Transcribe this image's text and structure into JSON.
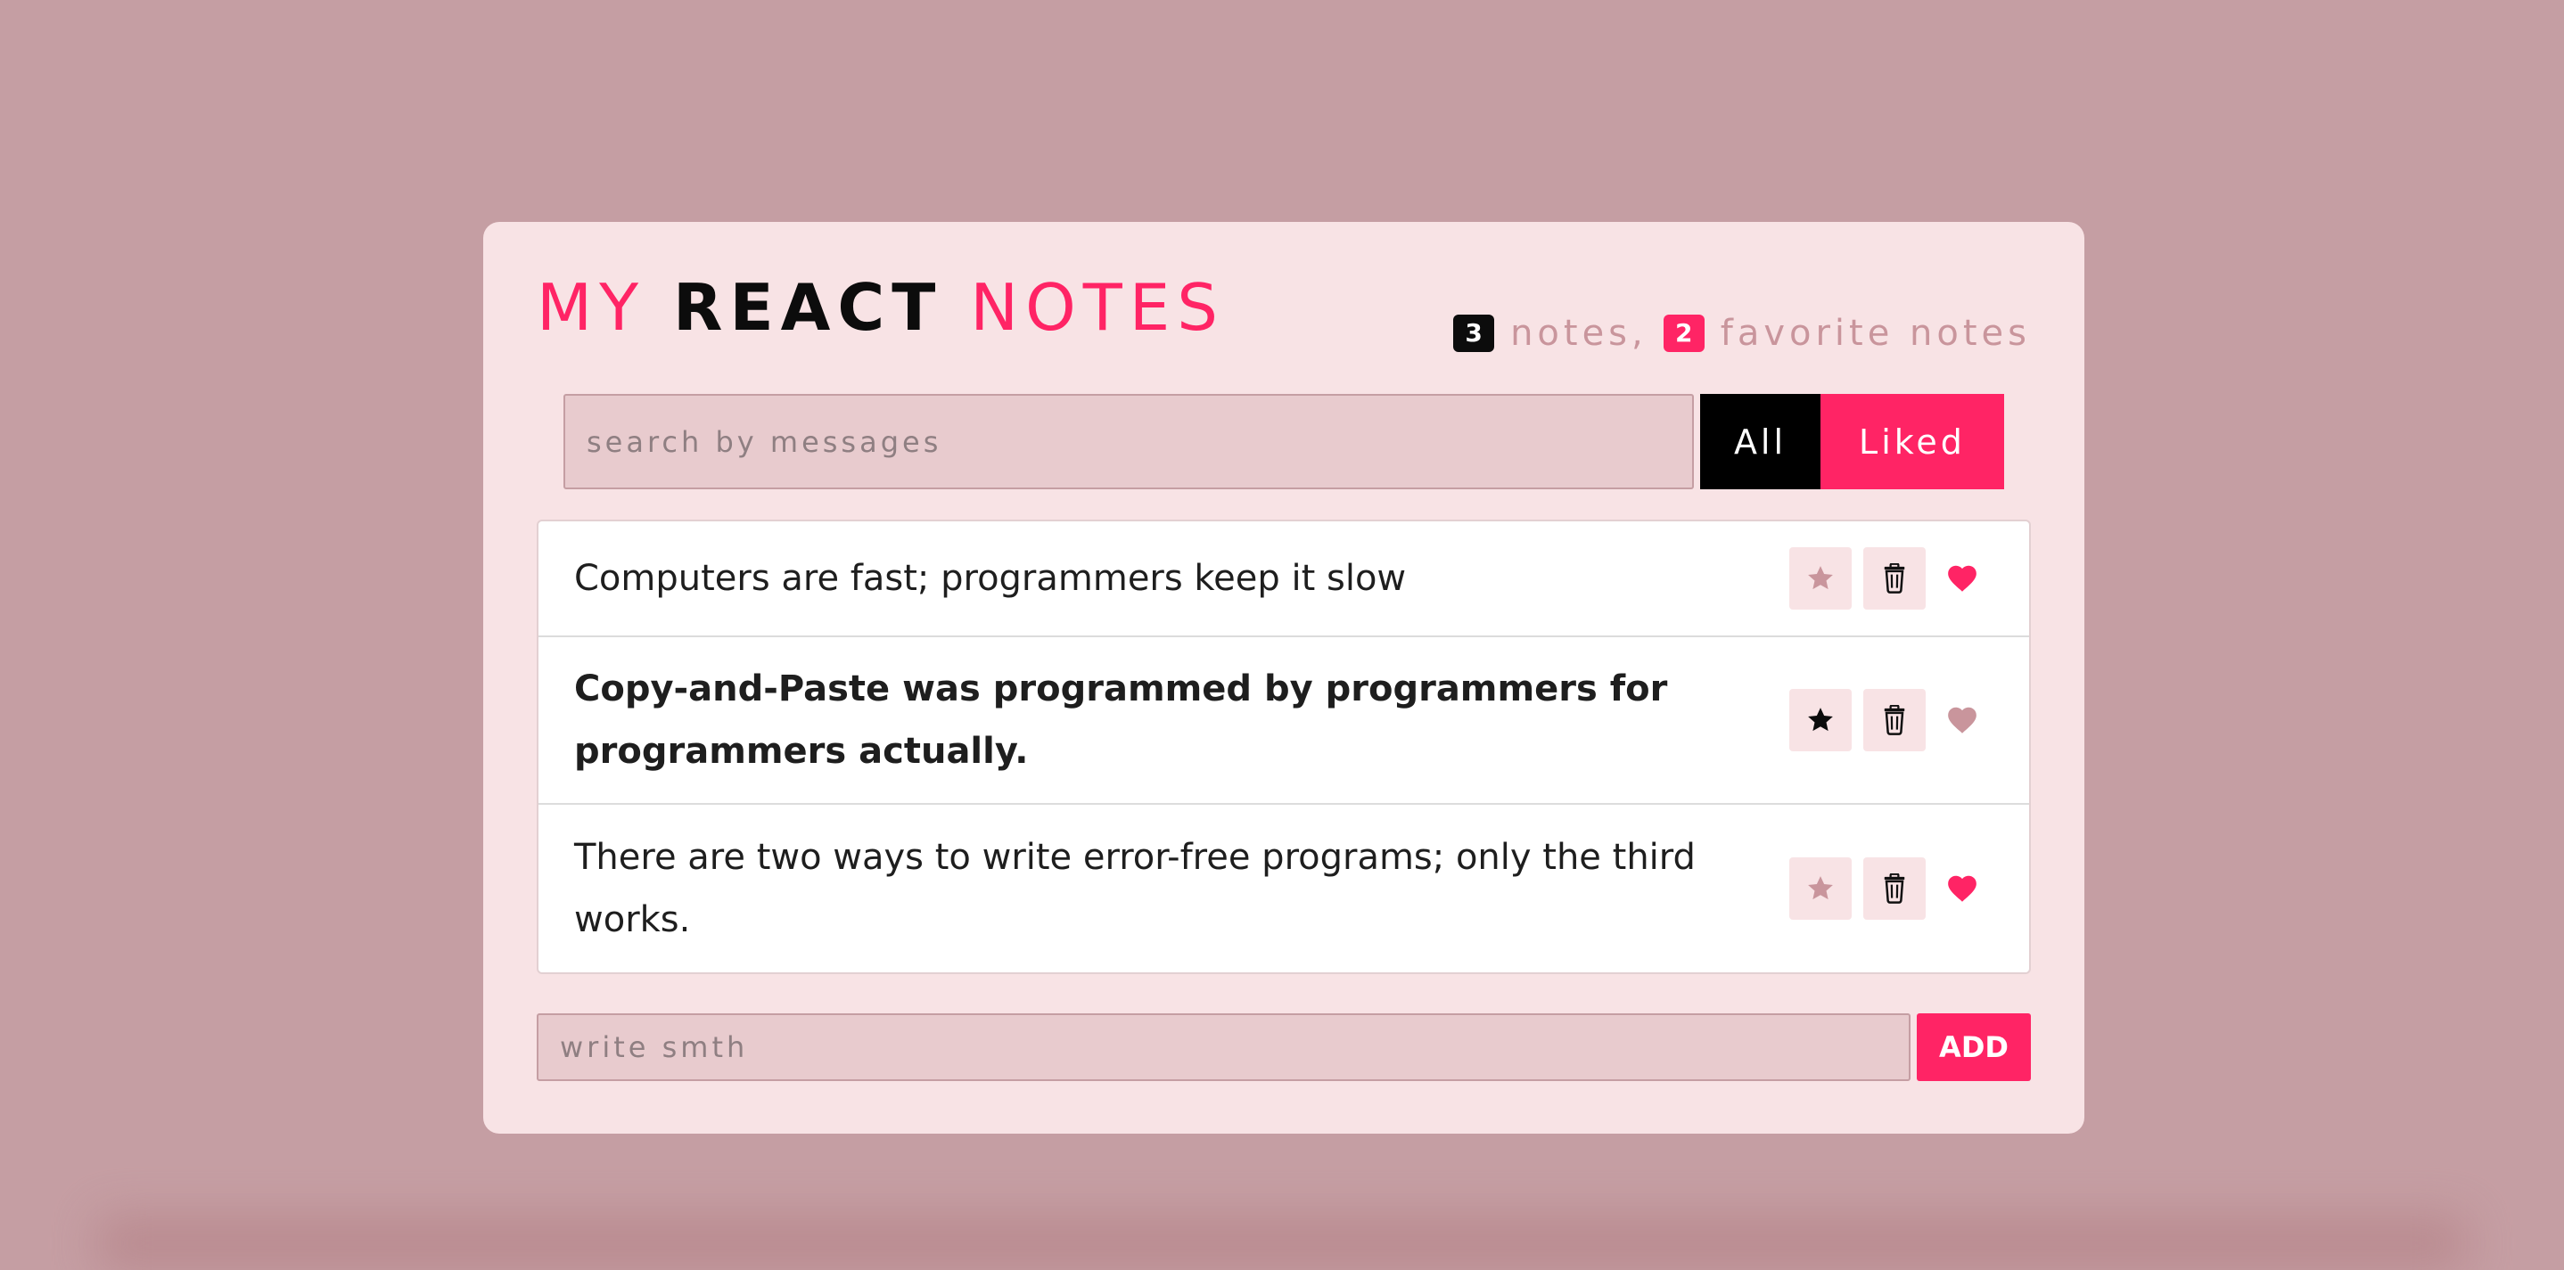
{
  "app": {
    "title_parts": [
      "MY",
      "REACT",
      "NOTES"
    ]
  },
  "counter": {
    "total": "3",
    "total_label": "notes,",
    "favorites": "2",
    "favorites_label": "favorite notes"
  },
  "search": {
    "placeholder": "search by messages",
    "value": ""
  },
  "filters": {
    "all_label": "All",
    "liked_label": "Liked"
  },
  "notes": [
    {
      "text": "Computers are fast; programmers keep it slow",
      "starred": false,
      "liked": true
    },
    {
      "text": "Copy-and-Paste was programmed by programmers for programmers actually.",
      "starred": true,
      "liked": false
    },
    {
      "text": "There are two ways to write error-free programs; only the third works.",
      "starred": false,
      "liked": true
    }
  ],
  "add": {
    "placeholder": "write smth",
    "button_label": "ADD"
  },
  "colors": {
    "background": "#c59ea3",
    "card": "#f8e3e5",
    "accent": "#ff2465",
    "dark": "#0c0c0c",
    "muted": "#c9959c"
  },
  "icons": {
    "star": "star-icon",
    "trash": "trash-icon",
    "heart": "heart-icon"
  }
}
